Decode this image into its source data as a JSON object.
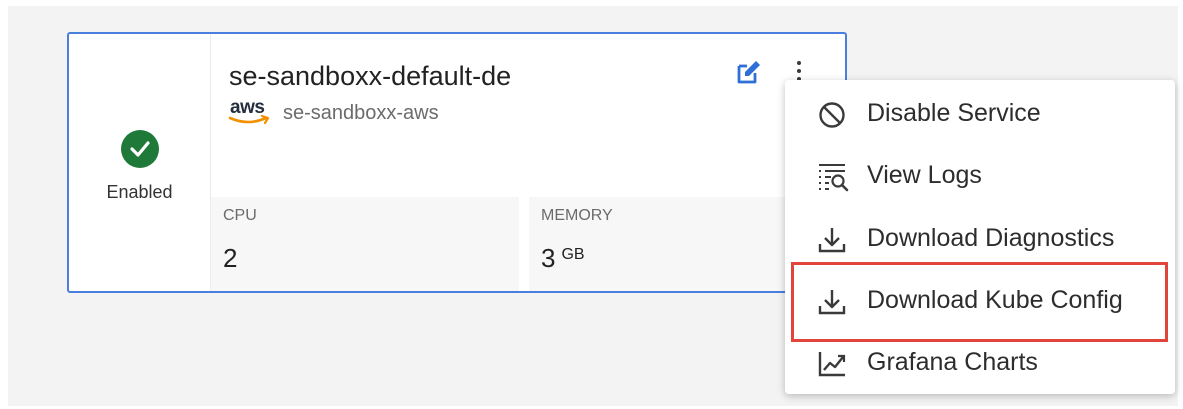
{
  "service": {
    "status_label": "Enabled",
    "name": "se-sandboxx-default-de",
    "provider_logo_text": "aws",
    "account_name": "se-sandboxx-aws",
    "stats": [
      {
        "label": "CPU",
        "value": "2",
        "unit": ""
      },
      {
        "label": "MEMORY",
        "value": "3",
        "unit": "GB"
      }
    ]
  },
  "menu": {
    "items": [
      {
        "label": "Disable Service",
        "icon": "disable-icon"
      },
      {
        "label": "View Logs",
        "icon": "view-logs-icon"
      },
      {
        "label": "Download Diagnostics",
        "icon": "download-icon"
      },
      {
        "label": "Download Kube Config",
        "icon": "download-icon",
        "highlighted": true
      },
      {
        "label": "Grafana Charts",
        "icon": "chart-icon"
      }
    ]
  },
  "colors": {
    "card_border": "#4a7fe0",
    "status_green": "#1f7a3a",
    "edit_icon_blue": "#2f6fd8",
    "highlight_red": "#e0443a",
    "aws_orange": "#f29100"
  }
}
